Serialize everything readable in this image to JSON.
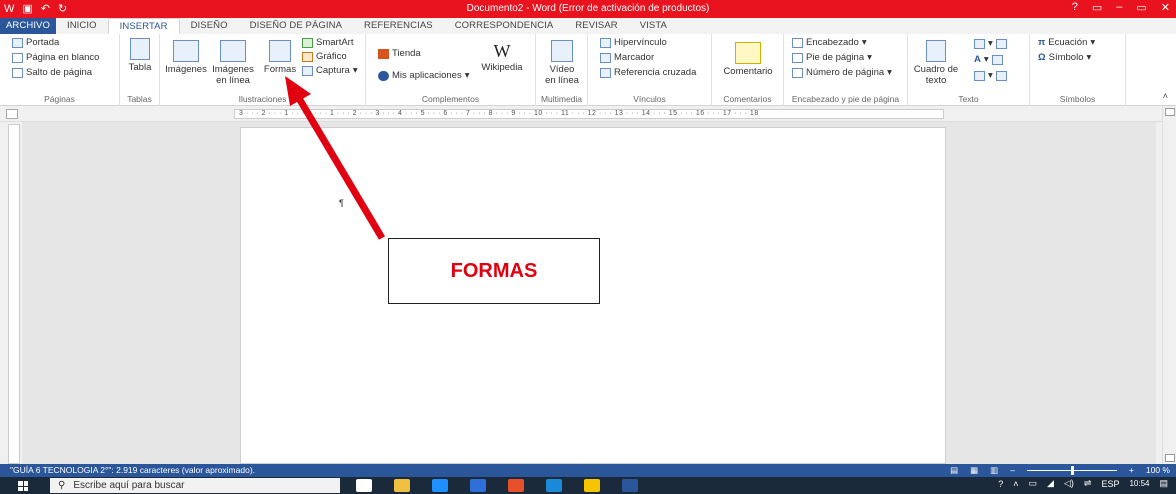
{
  "titlebar": {
    "title": "Documento2 - Word (Error de activación de productos)",
    "qa_save": "▣",
    "qa_undo": "↶",
    "qa_redo": "↻",
    "help": "?",
    "minimize": "–",
    "restore": "▭",
    "close": "✕"
  },
  "tabs": [
    "ARCHIVO",
    "INICIO",
    "INSERTAR",
    "DISEÑO",
    "DISEÑO DE PÁGINA",
    "REFERENCIAS",
    "CORRESPONDENCIA",
    "REVISAR",
    "VISTA"
  ],
  "ribbon": {
    "paginas": {
      "label": "Páginas",
      "portada": "Portada",
      "blanco": "Página en blanco",
      "salto": "Salto de página"
    },
    "tablas": {
      "label": "Tablas",
      "tabla": "Tabla"
    },
    "ilustraciones": {
      "label": "Ilustraciones",
      "imagenes": "Imágenes",
      "imagenes_linea_1": "Imágenes",
      "imagenes_linea_2": "en línea",
      "formas": "Formas",
      "smartart": "SmartArt",
      "grafico": "Gráfico",
      "captura": "Captura"
    },
    "complementos": {
      "label": "Complementos",
      "tienda": "Tienda",
      "mis_apps": "Mis aplicaciones",
      "wikipedia": "Wikipedia"
    },
    "multimedia": {
      "label": "Multimedia",
      "video_1": "Vídeo",
      "video_2": "en línea"
    },
    "vinculos": {
      "label": "Vínculos",
      "hipervinculo": "Hipervínculo",
      "marcador": "Marcador",
      "referencia": "Referencia cruzada"
    },
    "comentarios": {
      "label": "Comentarios",
      "comentario": "Comentario"
    },
    "encabezado": {
      "label": "Encabezado y pie de página",
      "encabezado": "Encabezado",
      "pie": "Pie de página",
      "numero": "Número de página"
    },
    "texto": {
      "label": "Texto",
      "cuadro_1": "Cuadro de",
      "cuadro_2": "texto"
    },
    "simbolos": {
      "label": "Símbolos",
      "ecuacion": "Ecuación",
      "simbolo": "Símbolo"
    }
  },
  "ruler": {
    "ticks": "3 · · · 2 · · · 1 · · · ⌂ · · · 1 · · · 2 · · · 3 · · · 4 · · · 5 · · · 6 · · · 7 · · · 8 · · · 9 · · · 10 · · · 11 · · · 12 · · · 13 · · · 14 · · · 15 · · · 16 · · · 17 · · · 18"
  },
  "document": {
    "paragraph_mark": "¶"
  },
  "callout": {
    "text": "FORMAS"
  },
  "statusbar": {
    "text": "\"GUÍA 6 TECNOLOGIA 2°\": 2.919 caracteres (valor aproximado).",
    "zoom": "100 %",
    "zoom_minus": "–",
    "zoom_plus": "+"
  },
  "taskbar": {
    "search_placeholder": "Escribe aquí para buscar",
    "lang": "ESP",
    "time": "10:54",
    "icon_colors": [
      "#ffffff",
      "#f0c040",
      "#1e90ff",
      "#2f6fd8",
      "#e8502a",
      "#1a8ad8",
      "#f7c400",
      "#2b579a"
    ]
  }
}
